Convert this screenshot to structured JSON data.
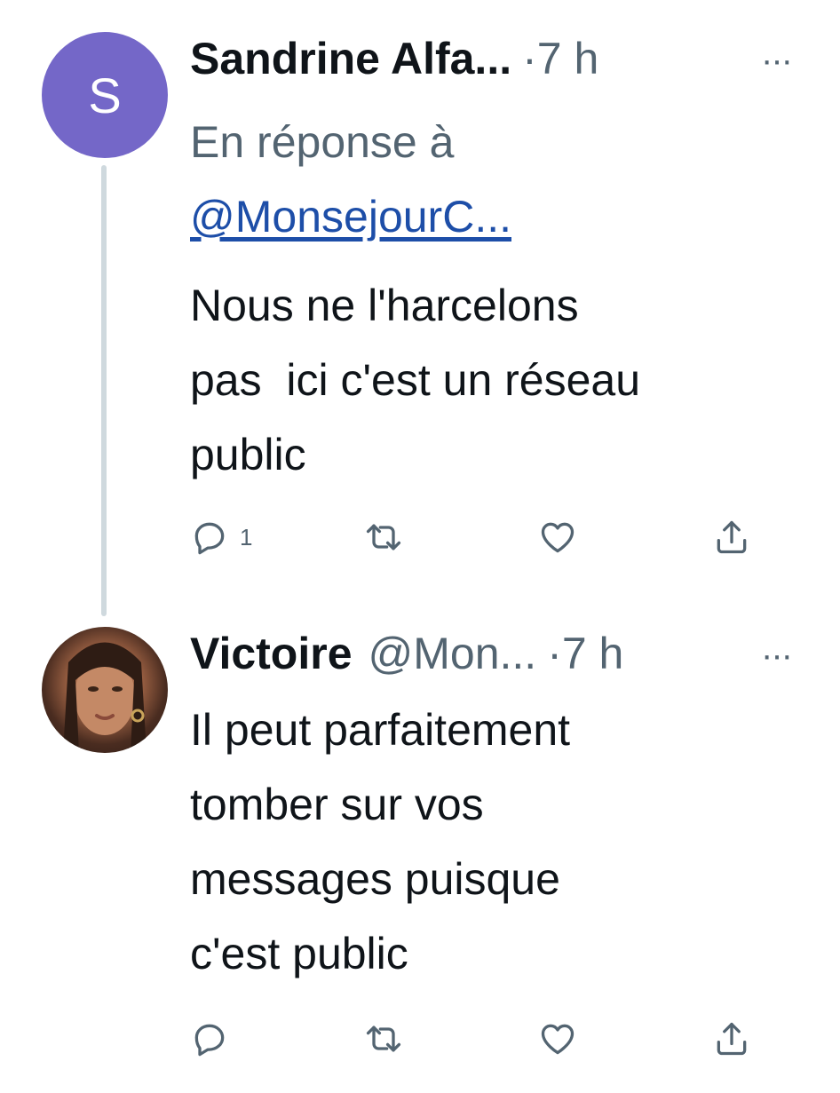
{
  "tweets": [
    {
      "avatar_letter": "S",
      "name": "Sandrine Alfa...",
      "dot": "·",
      "time": "7 h",
      "more": "···",
      "reply_prefix": "En réponse à",
      "reply_mention": "@MonsejourC...",
      "lines": [
        "Nous ne l'harcelons",
        "pas  ici c'est un réseau",
        "public"
      ],
      "reply_count": "1"
    },
    {
      "name": "Victoire",
      "handle": "@Mon...",
      "dot": "·",
      "time": "7 h",
      "more": "···",
      "lines": [
        "Il peut parfaitement",
        "tomber sur vos",
        "messages puisque",
        "c'est public"
      ],
      "reply_count": ""
    }
  ],
  "icons": {
    "reply": "reply-icon",
    "retweet": "retweet-icon",
    "like": "heart-icon",
    "share": "share-icon"
  },
  "colors": {
    "text": "#0f1419",
    "secondary": "#536471",
    "link": "#1d4ea8",
    "avatar_bg": "#7467c8",
    "thread_line": "#cfd9de"
  }
}
